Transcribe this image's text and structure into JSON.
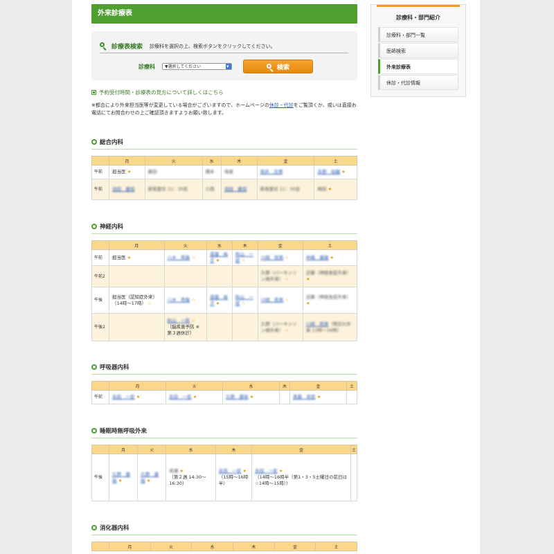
{
  "page_title": "外来診療表",
  "search": {
    "title": "診療表検索",
    "note": "診療科を選択の上、検索ボタンをクリックしてください。",
    "field_label": "診療科",
    "select_value": "▼選択してください",
    "button_label": "検索"
  },
  "info_link": "予約受付時間・診療表の見方について詳しくはこちら",
  "notice": {
    "before": "※都合により外来担当医等が変更している場合がございますので、ホームページの",
    "link": "休診・代診",
    "after": "をご覧頂くか、或いは直接お電話にてお問合わせの上ご確認頂きますようお願い致します。"
  },
  "days": [
    "月",
    "火",
    "水",
    "木",
    "金",
    "土"
  ],
  "departments": [
    {
      "name": "総合内科",
      "rows": [
        {
          "slot": "午前",
          "alt": false,
          "cells": [
            {
              "text": "担当医",
              "star": "★"
            },
            {
              "blur": "藤田"
            },
            {
              "blur": "橋本"
            },
            {
              "blur": "保屋"
            },
            {
              "doc": "鳥井　文博"
            },
            {
              "doc": "永野　佑輔",
              "star": "★"
            }
          ]
        },
        {
          "slot": "午前",
          "alt": true,
          "cells": [
            {
              "doc": "池田　慶但"
            },
            {
              "blur": "新坂霊任 11：30迄"
            },
            {
              "blur": "小西"
            },
            {
              "doc": "池田　慶但"
            },
            {
              "blur": "新坂霊任 11：30迄"
            },
            {
              "blur": "梅田",
              "star": "★"
            }
          ]
        }
      ]
    },
    {
      "name": "神経内科",
      "rows": [
        {
          "slot": "午前",
          "alt": false,
          "cells": [
            {
              "text": "担当医",
              "star": "★"
            },
            {
              "doc": "八木　秀雄",
              "star": "☆"
            },
            {
              "doc": "渡邉　裕子",
              "star": "★"
            },
            {
              "doc": "秋山　一郎",
              "star": "☆"
            },
            {
              "doc": "川崎　照美",
              "star": "☆"
            },
            {
              "doc": "仲嶋　康雄",
              "star": "★"
            }
          ]
        },
        {
          "slot": "午前2",
          "alt": true,
          "cells": [
            {},
            {},
            {},
            {},
            {
              "blur": "久野（パーキンソン病外来）",
              "star": "☆"
            },
            {
              "blur": "近藤（神経免疫外来）",
              "star": "★"
            }
          ]
        },
        {
          "slot": "午後",
          "alt": false,
          "cells": [
            {
              "text": "担当医（認知症外来）（14時〜17時）",
              "star": "☆"
            },
            {
              "doc": "八木　秀雄",
              "star": "☆"
            },
            {
              "doc": "渡邉　裕子",
              "star": "★"
            },
            {
              "doc": "秋山　一郎",
              "star": "☆"
            },
            {
              "doc": "川崎　照美",
              "star": "☆"
            },
            {
              "blur": "近藤（神経免疫外来）",
              "star": "★"
            }
          ]
        },
        {
          "slot": "午後2",
          "alt": true,
          "cells": [
            {},
            {
              "doc": "秋山　一郎",
              "star": "☆",
              "text": "（脳疾患予防 ※第３週休診）"
            },
            {},
            {},
            {
              "blur": "久野（パーキンソン病外来）",
              "star": "☆"
            },
            {
              "doc": "川崎　照美",
              "blur": "（物忘れ外来 13時〜16時）"
            }
          ]
        }
      ]
    },
    {
      "name": "呼吸器内科",
      "rows": [
        {
          "slot": "午前",
          "alt": false,
          "cells": [
            {
              "doc": "永田　一宏",
              "star": "★"
            },
            {
              "doc": "永田　一宏",
              "star": "★"
            },
            {
              "doc": "久野　康裕",
              "star": "★"
            },
            {},
            {
              "doc": "奥薗　崇宏",
              "star": "★"
            },
            {}
          ]
        }
      ]
    },
    {
      "name": "睡眠時無呼吸外来",
      "rows": [
        {
          "slot": "午後",
          "alt": false,
          "cells": [
            {
              "doc": "久野　康裕",
              "star": "★"
            },
            {
              "doc": "久野　康裕",
              "star": "★"
            },
            {
              "blur": "岩瀬",
              "text": "（第２週 14:30〜16:30）",
              "star": "★"
            },
            {
              "doc": "永田　一宏",
              "star": "★",
              "text": "（15時〜16時半）"
            },
            {
              "doc": "永田　一宏",
              "star": "★",
              "text": "（14時〜16時半（第1・3・5土曜日の前日は☆14時〜15時））"
            },
            {}
          ]
        }
      ]
    },
    {
      "name": "消化器内科",
      "rows": []
    }
  ],
  "sidebar": {
    "title": "診療科・部門紹介",
    "items": [
      {
        "label": "診療科・部門一覧",
        "active": false
      },
      {
        "label": "医師検索",
        "active": false
      },
      {
        "label": "外来診療表",
        "active": true
      },
      {
        "label": "休診・代診情報",
        "active": false
      }
    ]
  },
  "colors": {
    "header_green": "#4e9e32",
    "table_header": "#fbd78b",
    "alt_row": "#fdf3dc",
    "star": "#e8a115",
    "button_orange": "#f29a1e"
  }
}
